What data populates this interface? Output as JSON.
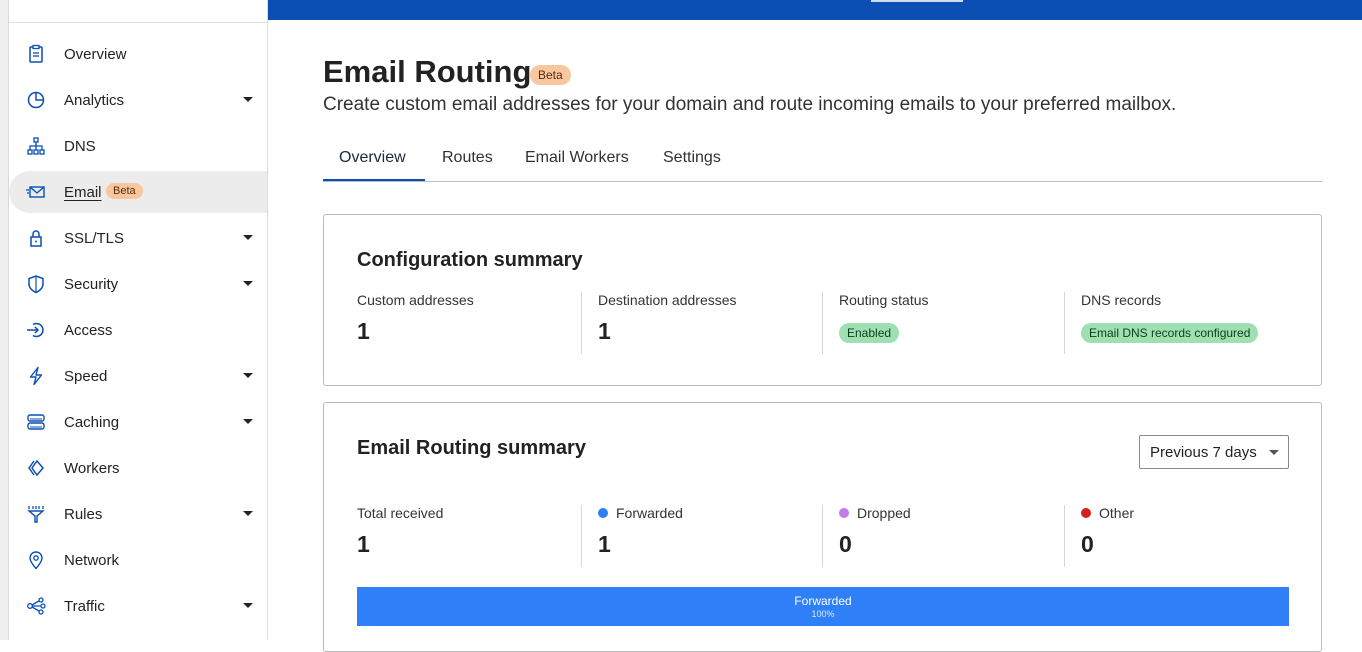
{
  "sidebar": {
    "items": [
      {
        "label": "Overview",
        "icon": "clipboard-icon",
        "dropdown": false
      },
      {
        "label": "Analytics",
        "icon": "pie-chart-icon",
        "dropdown": true
      },
      {
        "label": "DNS",
        "icon": "network-tree-icon",
        "dropdown": false
      },
      {
        "label": "Email",
        "icon": "envelope-icon",
        "dropdown": false,
        "active": true,
        "badge": "Beta"
      },
      {
        "label": "SSL/TLS",
        "icon": "lock-icon",
        "dropdown": true
      },
      {
        "label": "Security",
        "icon": "shield-icon",
        "dropdown": true
      },
      {
        "label": "Access",
        "icon": "access-arrow-icon",
        "dropdown": false
      },
      {
        "label": "Speed",
        "icon": "lightning-icon",
        "dropdown": true
      },
      {
        "label": "Caching",
        "icon": "server-stack-icon",
        "dropdown": true
      },
      {
        "label": "Workers",
        "icon": "workers-chevrons-icon",
        "dropdown": false
      },
      {
        "label": "Rules",
        "icon": "filter-funnel-icon",
        "dropdown": true
      },
      {
        "label": "Network",
        "icon": "location-pin-icon",
        "dropdown": false
      },
      {
        "label": "Traffic",
        "icon": "traffic-nodes-icon",
        "dropdown": true
      }
    ]
  },
  "page": {
    "title": "Email Routing",
    "title_badge": "Beta",
    "subtitle": "Create custom email addresses for your domain and route incoming emails to your preferred mailbox."
  },
  "tabs": [
    {
      "label": "Overview",
      "active": true
    },
    {
      "label": "Routes"
    },
    {
      "label": "Email Workers"
    },
    {
      "label": "Settings"
    }
  ],
  "config_summary": {
    "title": "Configuration summary",
    "custom_addresses": {
      "label": "Custom addresses",
      "value": "1"
    },
    "destination_addresses": {
      "label": "Destination addresses",
      "value": "1"
    },
    "routing_status": {
      "label": "Routing status",
      "value": "Enabled"
    },
    "dns_records": {
      "label": "DNS records",
      "value": "Email DNS records configured"
    }
  },
  "routing_summary": {
    "title": "Email Routing summary",
    "period": "Previous 7 days",
    "total_received": {
      "label": "Total received",
      "value": "1"
    },
    "forwarded": {
      "label": "Forwarded",
      "value": "1",
      "color": "#2f80f8"
    },
    "dropped": {
      "label": "Dropped",
      "value": "0",
      "color": "#c27be8"
    },
    "other": {
      "label": "Other",
      "value": "0",
      "color": "#d61f1f"
    },
    "bar": {
      "label": "Forwarded",
      "percent_text": "100%",
      "fraction": 1.0,
      "color": "#2f80f8"
    }
  }
}
